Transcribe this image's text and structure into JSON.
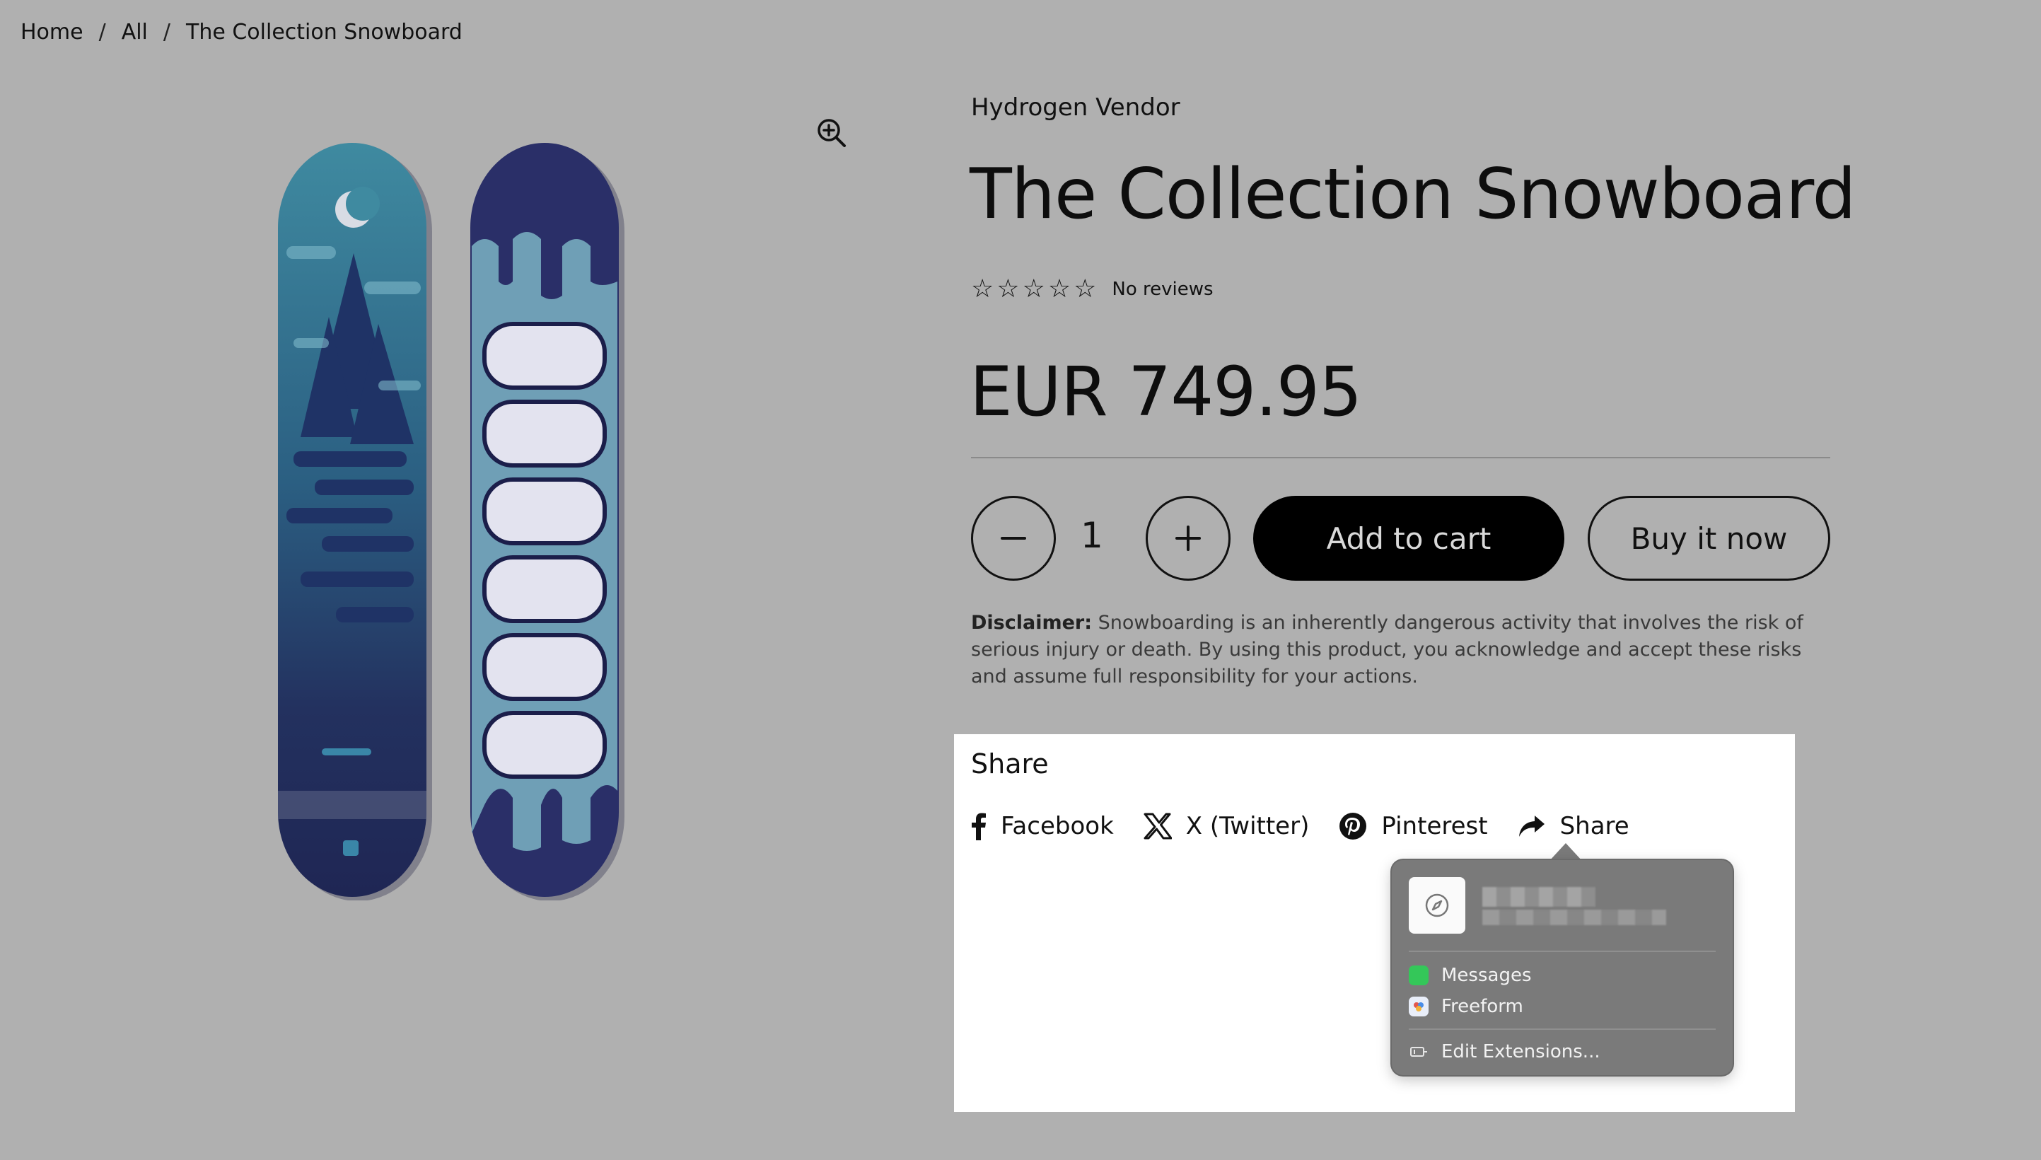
{
  "breadcrumb": {
    "items": [
      "Home",
      "All",
      "The Collection Snowboard"
    ],
    "separator": "/"
  },
  "product": {
    "vendor": "Hydrogen Vendor",
    "title": "The Collection Snowboard",
    "rating": {
      "stars": 5,
      "filled": 0,
      "reviews_label": "No reviews"
    },
    "price": "EUR 749.95",
    "quantity": "1",
    "add_to_cart_label": "Add to cart",
    "buy_now_label": "Buy it now",
    "disclaimer_label": "Disclaimer:",
    "disclaimer_text": " Snowboarding is an inherently dangerous activity that involves the risk of serious injury or death. By using this product, you acknowledge and accept these risks and assume full responsibility for your actions."
  },
  "share": {
    "title": "Share",
    "items": [
      {
        "label": "Facebook",
        "icon": "facebook-icon"
      },
      {
        "label": "X (Twitter)",
        "icon": "x-twitter-icon"
      },
      {
        "label": "Pinterest",
        "icon": "pinterest-icon"
      },
      {
        "label": "Share",
        "icon": "share-arrow-icon"
      }
    ],
    "popup": {
      "header_icon": "compass-icon",
      "apps": [
        {
          "label": "Messages",
          "icon": "messages-icon",
          "color": "#34c759"
        },
        {
          "label": "Freeform",
          "icon": "freeform-icon",
          "color": "#e9eef9"
        }
      ],
      "edit_label": "Edit Extensions...",
      "edit_icon": "extensions-icon"
    }
  },
  "colors": {
    "page_background": "#b0b0b0",
    "button_primary": "#000000",
    "share_panel": "#ffffff",
    "popup": "#7a7a7a"
  }
}
